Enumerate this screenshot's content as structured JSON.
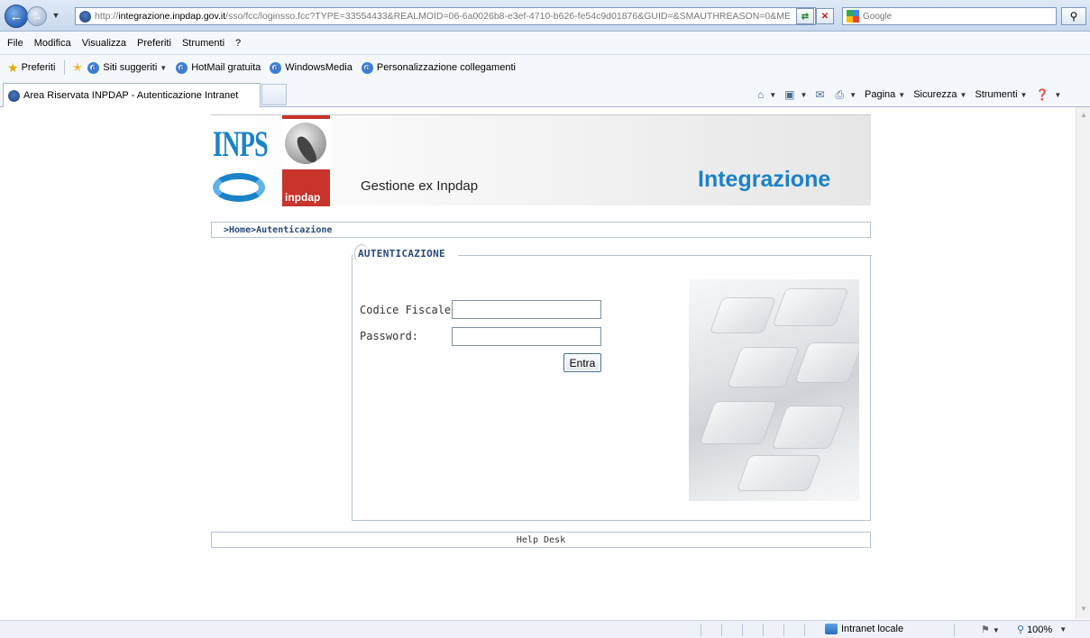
{
  "browser": {
    "url_prefix": "http://",
    "url_domain": "integrazione.inpdap.gov.it",
    "url_rest": "/sso/fcc/loginsso.fcc?TYPE=33554433&REALMOID=06-6a0026b8-e3ef-4710-b626-fe54c9d01876&GUID=&SMAUTHREASON=0&ME",
    "search_placeholder": "Google",
    "menu": [
      "File",
      "Modifica",
      "Visualizza",
      "Preferiti",
      "Strumenti",
      "?"
    ],
    "favorites_label": "Preferiti",
    "favorites": [
      "Siti suggeriti",
      "HotMail gratuita",
      "WindowsMedia",
      "Personalizzazione collegamenti"
    ],
    "tab_title": "Area Riservata INPDAP - Autenticazione Intranet",
    "commands": [
      "Pagina",
      "Sicurezza",
      "Strumenti"
    ],
    "status_zone": "Intranet locale",
    "zoom": "100%"
  },
  "page": {
    "logo_text": "INPS",
    "logo_sub": "inpdap",
    "header_subtitle": "Gestione ex Inpdap",
    "header_title": "Integrazione",
    "breadcrumb": ">Home>Autenticazione",
    "section_title": "AUTENTICAZIONE",
    "codice_fiscale_label": "Codice Fiscale:",
    "password_label": "Password:",
    "codice_fiscale_value": "",
    "password_value": "",
    "submit_label": "Entra",
    "footer_link": "Help Desk"
  },
  "colors": {
    "brand_blue": "#1a82c8",
    "inpdap_red": "#c8332b",
    "breadcrumb_text": "#27497a"
  }
}
